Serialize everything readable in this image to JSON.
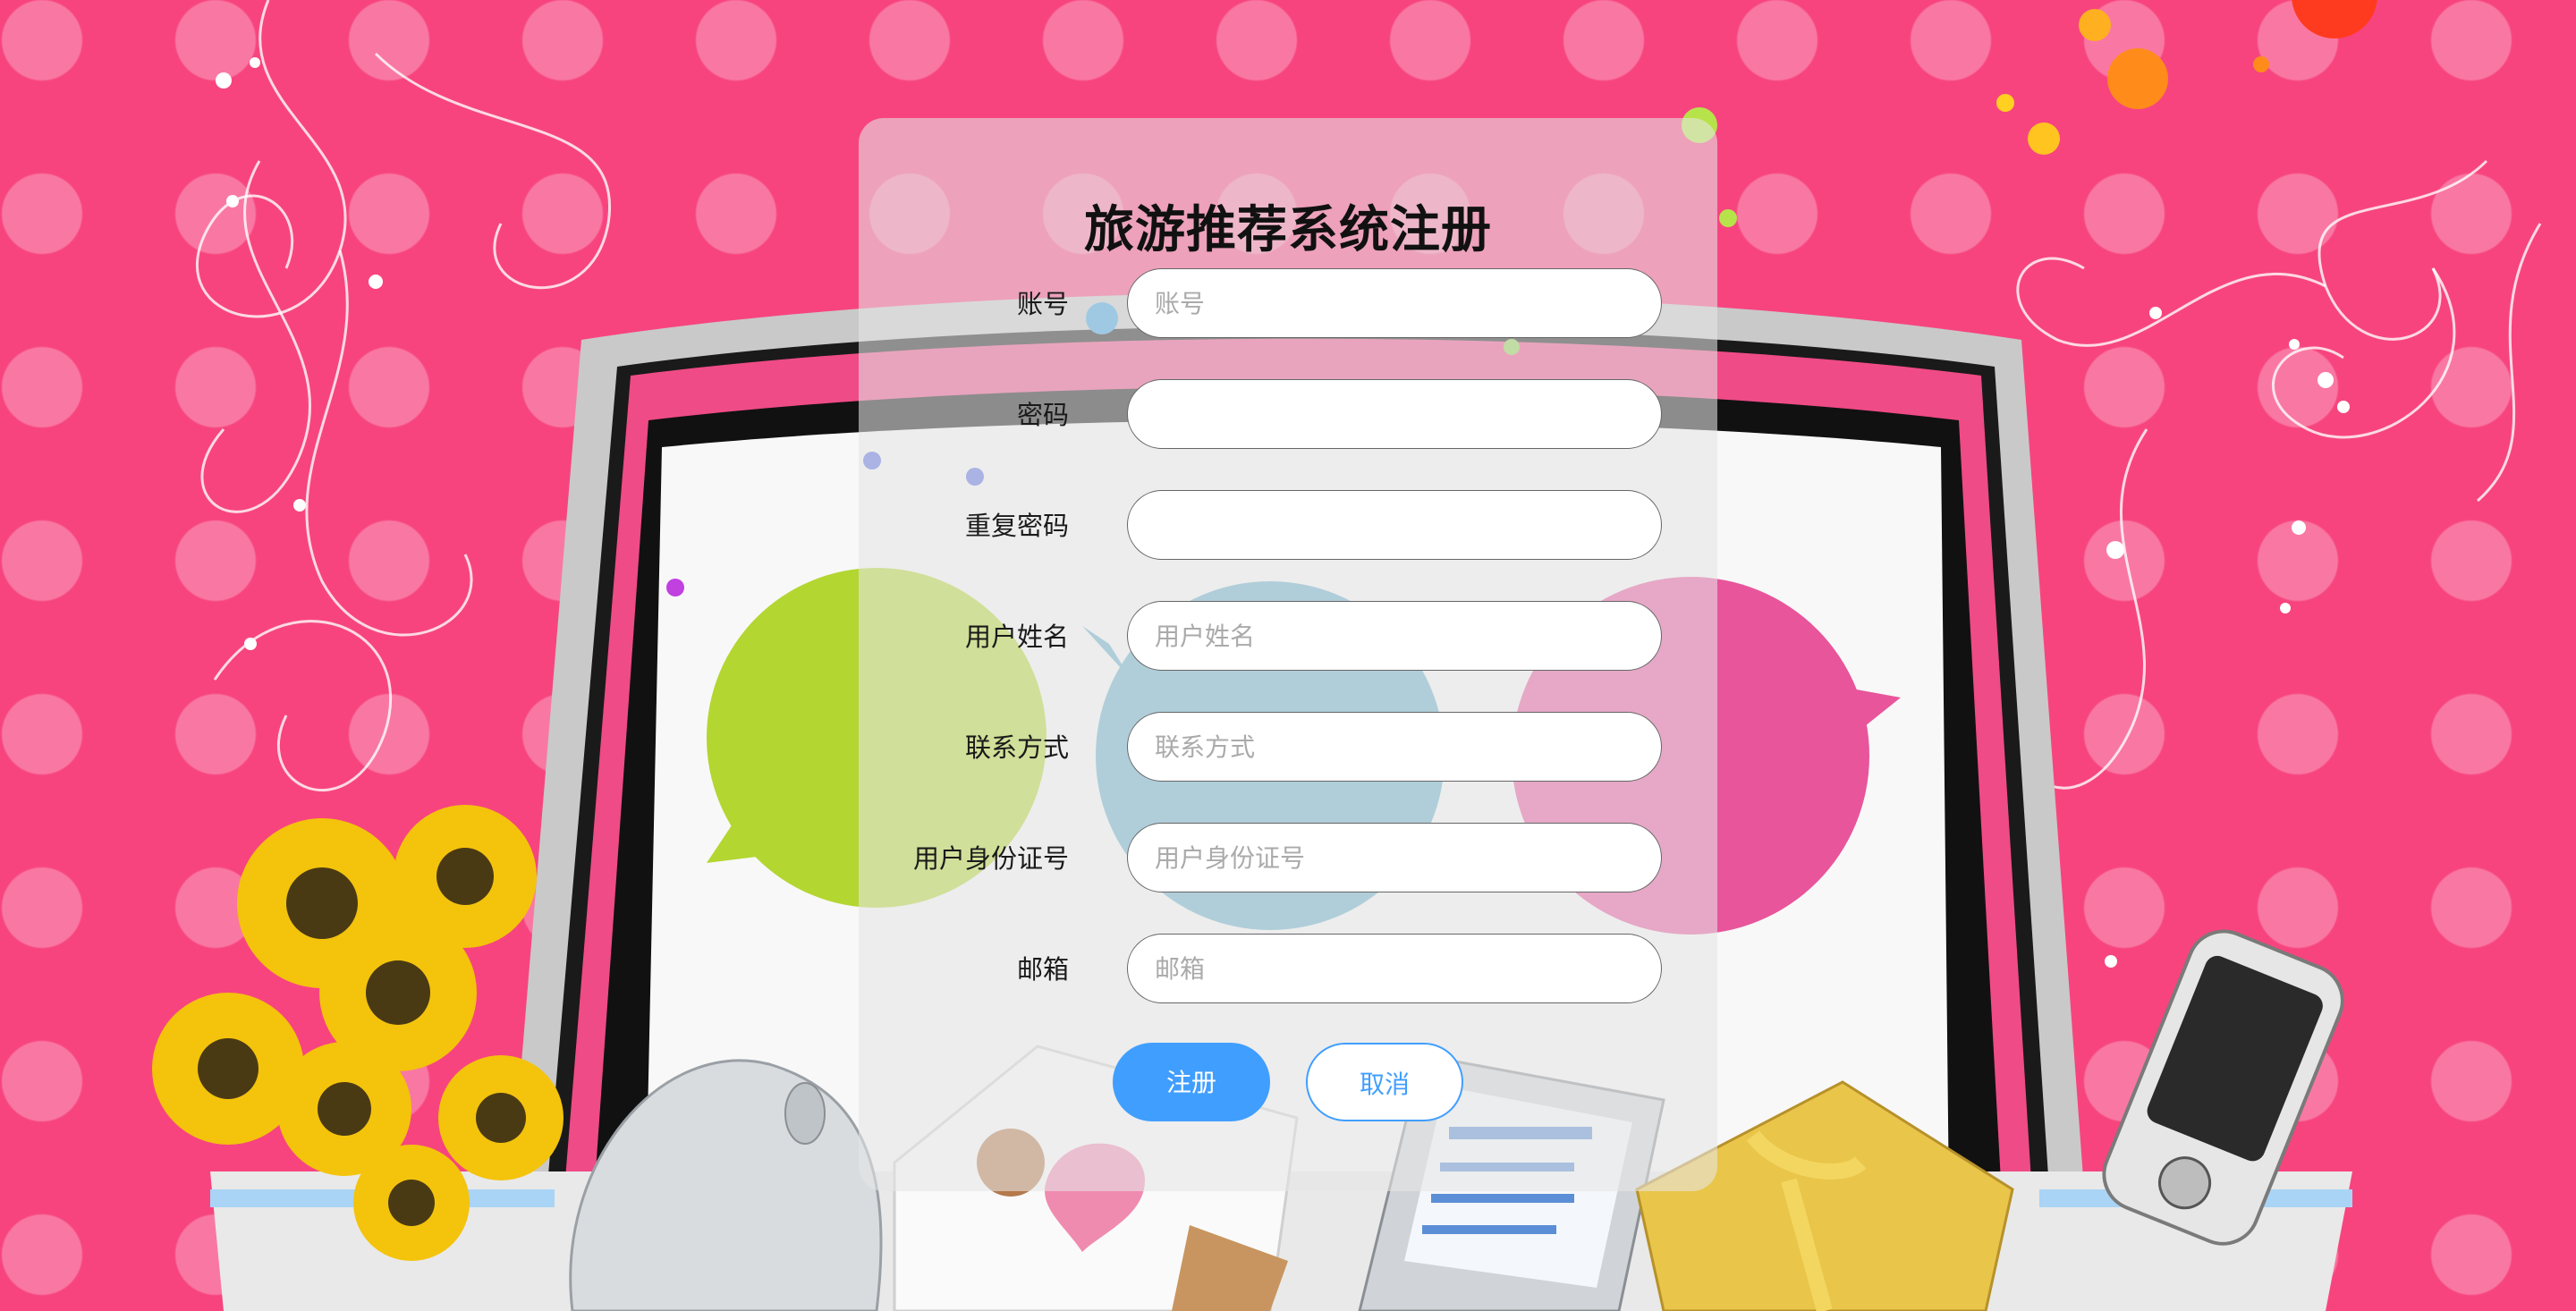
{
  "form": {
    "title": "旅游推荐系统注册",
    "fields": [
      {
        "label": "账号",
        "placeholder": "账号"
      },
      {
        "label": "密码",
        "placeholder": ""
      },
      {
        "label": "重复密码",
        "placeholder": ""
      },
      {
        "label": "用户姓名",
        "placeholder": "用户姓名"
      },
      {
        "label": "联系方式",
        "placeholder": "联系方式"
      },
      {
        "label": "用户身份证号",
        "placeholder": "用户身份证号"
      },
      {
        "label": "邮箱",
        "placeholder": "邮箱"
      }
    ],
    "register_label": "注册",
    "cancel_label": "取消"
  },
  "colors": {
    "background_pink": "#f7447f",
    "primary_button": "#409eff",
    "panel": "rgba(230,230,230,0.58)"
  }
}
